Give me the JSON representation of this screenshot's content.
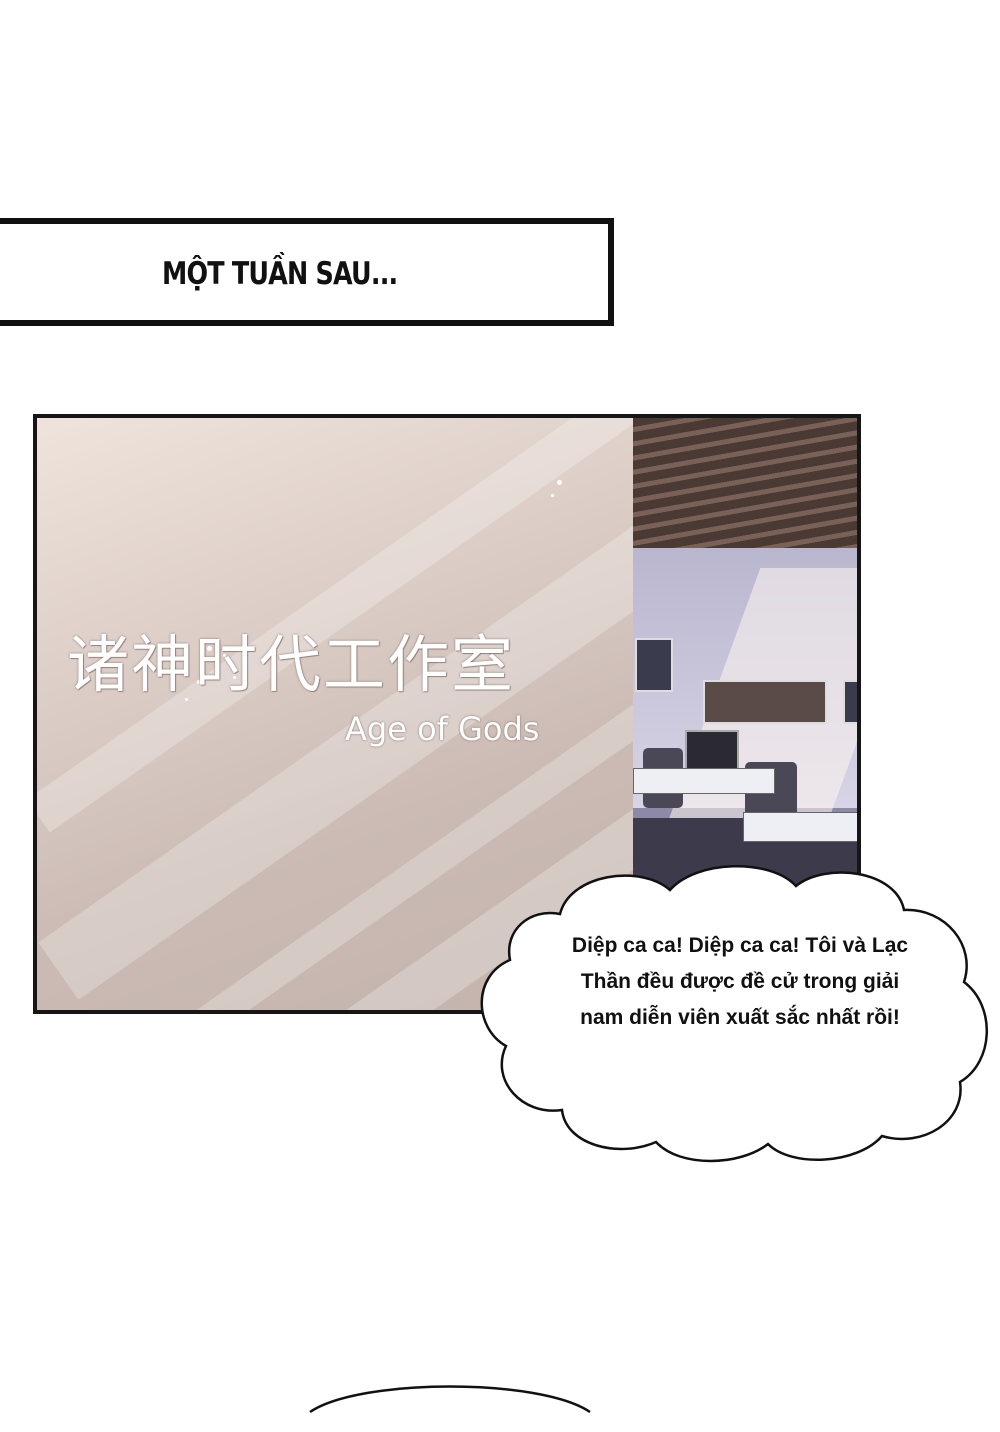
{
  "caption": {
    "text": "MỘT TUẦN SAU..."
  },
  "panel": {
    "logo_chinese": "诸神时代工作室",
    "logo_english": "Age of Gods"
  },
  "speech_bubble": {
    "text": "Diệp ca ca! Diệp ca ca! Tôi và Lạc Thần đều được đề cử trong giải nam diễn viên xuất sắc nhất rồi!"
  }
}
